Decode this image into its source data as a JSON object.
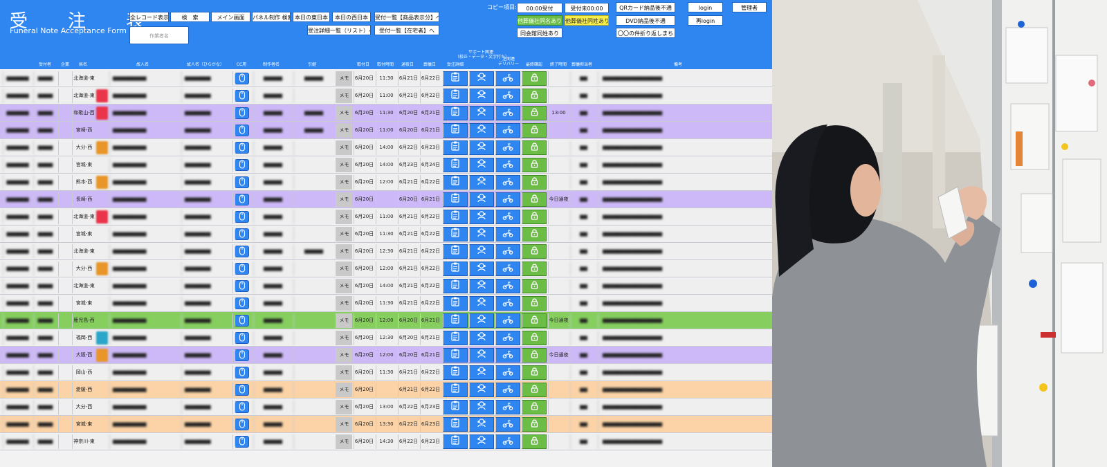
{
  "header": {
    "title": "受　注　表",
    "subtitle": "Funeral Note Acceptance Form",
    "author_placeholder": "作業者名",
    "copy_label": "コピー項目:",
    "buttons": {
      "all_records": "全レコード表示",
      "search": "検　索",
      "main_screen": "メイン画面",
      "panel_search": "パネル制作 検索",
      "today_east": "本日の東日本",
      "today_west": "本日の西日本",
      "list_by_product": "受付一覧【商品表示分】へ",
      "detail_list": "受注詳細一覧（リスト）へ",
      "list_stock": "受付一覧【在宅者】へ",
      "copy_time_received": "00:00受付",
      "copy_received_time": "受付未00:00",
      "other_hall_name": "他葬儀社同名あり",
      "other_hall_surname": "他葬儀社同姓あり",
      "same_hall_surname": "同会館同姓あり",
      "qr_no_delivery": "QRカード納品後不通",
      "dvd_no_delivery": "DVD納品後不通",
      "fold_return": "〇〇の件折り返しまち",
      "login": "login",
      "relogin": "再login",
      "admin": "管理者"
    }
  },
  "columns": {
    "no": "受付者",
    "company": "企業",
    "area": "県名",
    "deceased": "故人名",
    "deceased_kana": "故人名（ひらがな）",
    "cc": "CC用",
    "producer": "制作者名",
    "lead": "引継",
    "rcv_day": "取付日",
    "rcv_time": "取付時間",
    "tsuya_day": "通夜日",
    "sogi_day": "葬儀日",
    "order_detail": "受注詳細",
    "support": "サポート関連\n（校正・データ・文字打ち）",
    "delivery": "注関連\nデリバリー",
    "final": "最終確認",
    "end_time": "終了時間",
    "staff": "葬儀担当者",
    "remarks": "備考"
  },
  "labels": {
    "memo": "メモ"
  },
  "rows": [
    {
      "area": "北海道-東",
      "bg": "#efefef",
      "sq": "",
      "day": "6月20日",
      "time": "11:30",
      "tsuya": "6月21日",
      "sogi": "6月22日",
      "end": "",
      "lead": true
    },
    {
      "area": "北海道-東",
      "bg": "#efefef",
      "sq": "#e9344a",
      "day": "6月20日",
      "time": "11:00",
      "tsuya": "6月21日",
      "sogi": "6月22日",
      "end": "",
      "lead": false
    },
    {
      "area": "和歌山-西",
      "bg": "#cdb9f7",
      "sq": "#e9344a",
      "day": "6月20日",
      "time": "11:30",
      "tsuya": "6月20日",
      "sogi": "6月21日",
      "end": "13:00",
      "lead": true
    },
    {
      "area": "宮崎-西",
      "bg": "#cdb9f7",
      "sq": "",
      "day": "6月20日",
      "time": "11:00",
      "tsuya": "6月20日",
      "sogi": "6月21日",
      "end": "",
      "lead": true
    },
    {
      "area": "大分-西",
      "bg": "#efefef",
      "sq": "#e8962a",
      "day": "6月20日",
      "time": "14:00",
      "tsuya": "6月22日",
      "sogi": "6月23日",
      "end": "",
      "lead": false
    },
    {
      "area": "宮城-東",
      "bg": "#efefef",
      "sq": "",
      "day": "6月20日",
      "time": "14:00",
      "tsuya": "6月23日",
      "sogi": "6月24日",
      "end": "",
      "lead": false
    },
    {
      "area": "熊本-西",
      "bg": "#efefef",
      "sq": "#e8962a",
      "day": "6月20日",
      "time": "12:00",
      "tsuya": "6月21日",
      "sogi": "6月22日",
      "end": "",
      "lead": false
    },
    {
      "area": "長崎-西",
      "bg": "#cdb9f7",
      "sq": "",
      "day": "6月20日",
      "time": "",
      "tsuya": "6月20日",
      "sogi": "6月21日",
      "end": "今日通夜",
      "lead": false
    },
    {
      "area": "北海道-東",
      "bg": "#efefef",
      "sq": "#e9344a",
      "day": "6月20日",
      "time": "11:00",
      "tsuya": "6月21日",
      "sogi": "6月22日",
      "end": "",
      "lead": false
    },
    {
      "area": "宮城-東",
      "bg": "#efefef",
      "sq": "",
      "day": "6月20日",
      "time": "11:30",
      "tsuya": "6月21日",
      "sogi": "6月22日",
      "end": "",
      "lead": false
    },
    {
      "area": "北海道-東",
      "bg": "#efefef",
      "sq": "",
      "day": "6月20日",
      "time": "12:30",
      "tsuya": "6月21日",
      "sogi": "6月22日",
      "end": "",
      "lead": true
    },
    {
      "area": "大分-西",
      "bg": "#efefef",
      "sq": "#e8962a",
      "day": "6月20日",
      "time": "12:00",
      "tsuya": "6月21日",
      "sogi": "6月22日",
      "end": "",
      "lead": false
    },
    {
      "area": "北海道-東",
      "bg": "#efefef",
      "sq": "",
      "day": "6月20日",
      "time": "14:00",
      "tsuya": "6月21日",
      "sogi": "6月22日",
      "end": "",
      "lead": false
    },
    {
      "area": "宮城-東",
      "bg": "#efefef",
      "sq": "",
      "day": "6月20日",
      "time": "11:30",
      "tsuya": "6月21日",
      "sogi": "6月22日",
      "end": "",
      "lead": false
    },
    {
      "area": "鹿児島-西",
      "bg": "#86cf5f",
      "sq": "",
      "day": "6月20日",
      "time": "12:00",
      "tsuya": "6月20日",
      "sogi": "6月21日",
      "end": "今日通夜",
      "lead": false
    },
    {
      "area": "福岡-西",
      "bg": "#efefef",
      "sq": "#2aa6c9",
      "day": "6月20日",
      "time": "12:30",
      "tsuya": "6月20日",
      "sogi": "6月21日",
      "end": "",
      "lead": false
    },
    {
      "area": "大阪-西",
      "bg": "#cdb9f7",
      "sq": "#e8962a",
      "day": "6月20日",
      "time": "12:00",
      "tsuya": "6月20日",
      "sogi": "6月21日",
      "end": "今日通夜",
      "lead": false
    },
    {
      "area": "岡山-西",
      "bg": "#efefef",
      "sq": "",
      "day": "6月20日",
      "time": "11:30",
      "tsuya": "6月21日",
      "sogi": "6月22日",
      "end": "",
      "lead": false
    },
    {
      "area": "愛媛-西",
      "bg": "#fbd3a6",
      "sq": "",
      "day": "6月20日",
      "time": "",
      "tsuya": "6月21日",
      "sogi": "6月22日",
      "end": "",
      "lead": false
    },
    {
      "area": "大分-西",
      "bg": "#efefef",
      "sq": "",
      "day": "6月20日",
      "time": "13:00",
      "tsuya": "6月22日",
      "sogi": "6月23日",
      "end": "",
      "lead": false
    },
    {
      "area": "宮城-東",
      "bg": "#fbd3a6",
      "sq": "",
      "day": "6月20日",
      "time": "13:30",
      "tsuya": "6月22日",
      "sogi": "6月23日",
      "end": "",
      "lead": false
    },
    {
      "area": "神奈川-東",
      "bg": "#efefef",
      "sq": "",
      "day": "6月20日",
      "time": "14:30",
      "tsuya": "6月22日",
      "sogi": "6月23日",
      "end": "",
      "lead": false
    }
  ]
}
